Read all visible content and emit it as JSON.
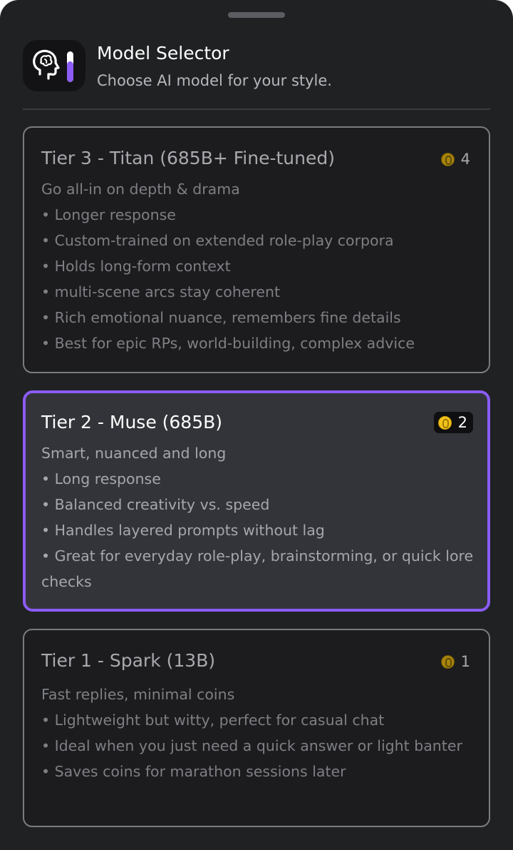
{
  "header": {
    "title": "Model Selector",
    "subtitle": "Choose AI model for your style.",
    "icon": "brain-head-icon"
  },
  "colors": {
    "accent": "#8b5cf6",
    "background": "#202123",
    "coin": "#f2c21b"
  },
  "tiers": [
    {
      "title": "Tier 3 - Titan (685B+ Fine-tuned)",
      "cost": "4",
      "selected": false,
      "lines": [
        "Go all-in on depth & drama",
        "• Longer response",
        "• Custom-trained on extended role-play corpora",
        "• Holds long-form context",
        "• multi-scene arcs stay coherent",
        "• Rich emotional nuance, remembers fine details",
        "• Best for epic RPs, world-building, complex advice"
      ]
    },
    {
      "title": "Tier 2 - Muse (685B)",
      "cost": "2",
      "selected": true,
      "lines": [
        "Smart, nuanced and long",
        "• Long response",
        "• Balanced creativity vs. speed",
        "• Handles layered prompts without lag",
        "• Great for everyday role-play, brainstorming, or quick lore checks"
      ]
    },
    {
      "title": "Tier 1 - Spark (13B)",
      "cost": "1",
      "selected": false,
      "lines": [
        "Fast replies, minimal coins",
        "• Lightweight but witty, perfect for casual chat",
        "• Ideal when you just need a quick answer or light banter",
        "• Saves coins for marathon sessions later"
      ]
    }
  ]
}
